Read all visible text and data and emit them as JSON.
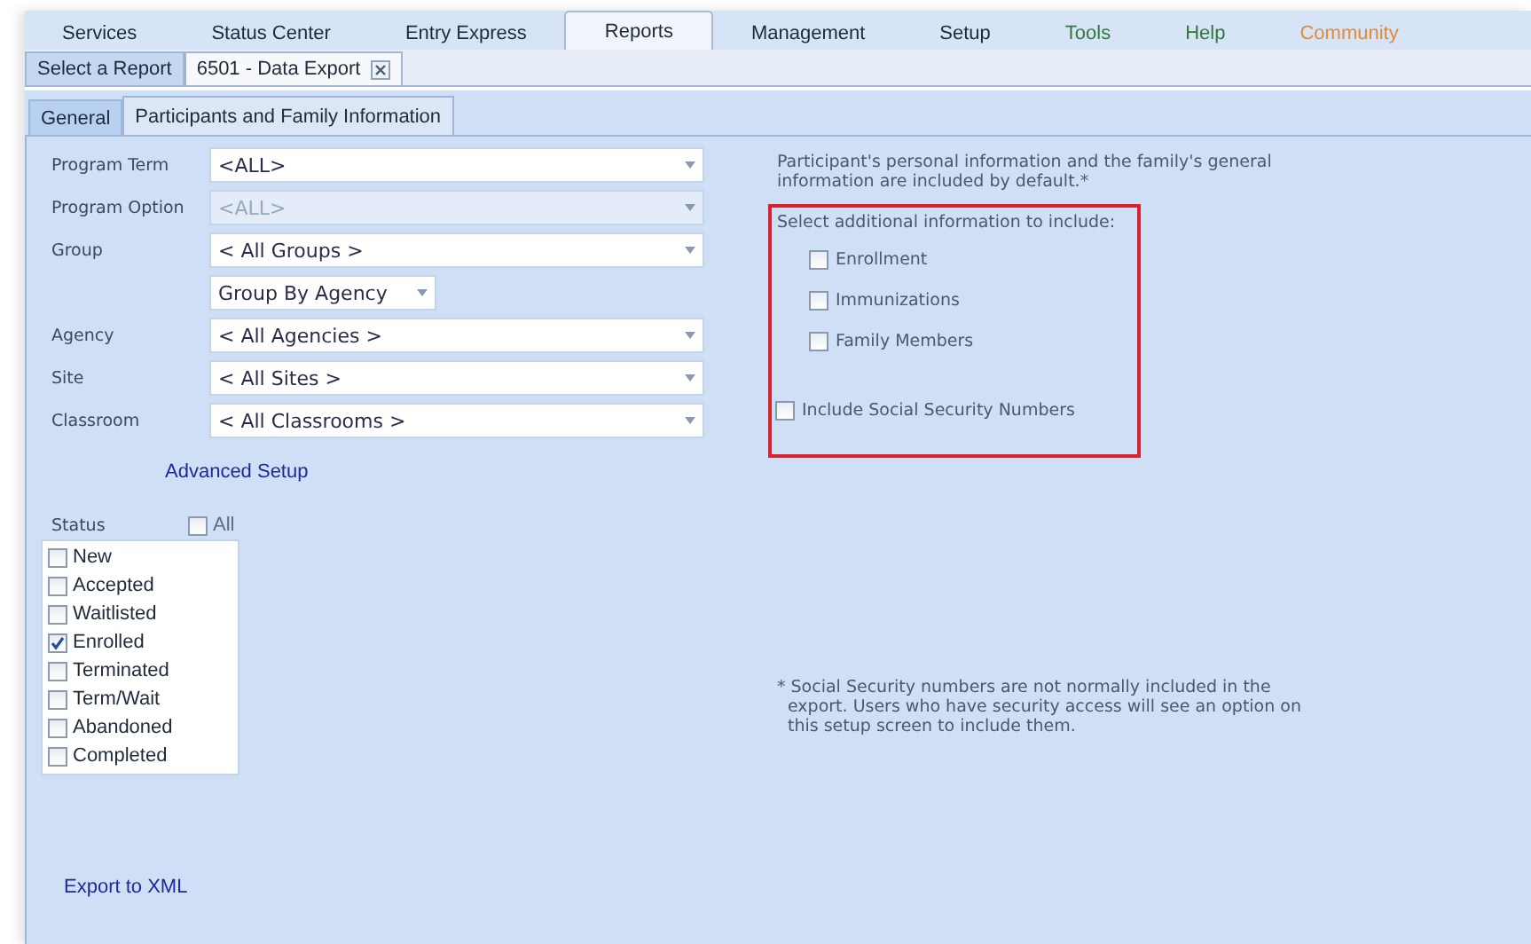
{
  "menu": [
    {
      "label": "Services",
      "selected": false,
      "color": "#1e2a3a"
    },
    {
      "label": "Status Center",
      "selected": false,
      "color": "#1e2a3a"
    },
    {
      "label": "Entry Express",
      "selected": false,
      "color": "#1e2a3a"
    },
    {
      "label": "Reports",
      "selected": true,
      "color": "#1e2a3a"
    },
    {
      "label": "Management",
      "selected": false,
      "color": "#1e2a3a"
    },
    {
      "label": "Setup",
      "selected": false,
      "color": "#1e2a3a"
    },
    {
      "label": "Tools",
      "selected": false,
      "color": "#2f7a3a"
    },
    {
      "label": "Help",
      "selected": false,
      "color": "#2f7a3a"
    },
    {
      "label": "Community",
      "selected": false,
      "color": "#e3893a"
    }
  ],
  "report_tabs": [
    {
      "label": "Select a Report",
      "selected": false,
      "closable": false
    },
    {
      "label": "6501 - Data Export",
      "selected": true,
      "closable": true
    }
  ],
  "sub_tabs": [
    {
      "label": "General",
      "selected": false
    },
    {
      "label": "Participants and Family Information",
      "selected": true
    }
  ],
  "filters": [
    {
      "kind": "combo",
      "label": "Program Term",
      "value": "<ALL>",
      "disabled": false
    },
    {
      "kind": "combo",
      "label": "Program Option",
      "value": "<ALL>",
      "disabled": true
    },
    {
      "kind": "combo",
      "label": "Group",
      "value": "< All Groups >",
      "disabled": false
    },
    {
      "kind": "short-combo",
      "value": "Group By Agency",
      "disabled": false
    },
    {
      "kind": "combo",
      "label": "Agency",
      "value": "< All Agencies >",
      "disabled": false
    },
    {
      "kind": "combo",
      "label": "Site",
      "value": "< All Sites >",
      "disabled": false
    },
    {
      "kind": "combo",
      "label": "Classroom",
      "value": "< All Classrooms >",
      "disabled": false
    }
  ],
  "advanced_link": "Advanced Setup",
  "status": {
    "label": "Status",
    "all": {
      "label": "All",
      "checked": false
    },
    "items": [
      {
        "label": "New",
        "checked": false
      },
      {
        "label": "Accepted",
        "checked": false
      },
      {
        "label": "Waitlisted",
        "checked": false
      },
      {
        "label": "Enrolled",
        "checked": true
      },
      {
        "label": "Terminated",
        "checked": false
      },
      {
        "label": "Term/Wait",
        "checked": false
      },
      {
        "label": "Abandoned",
        "checked": false
      },
      {
        "label": "Completed",
        "checked": false
      }
    ]
  },
  "export_link": "Export to XML",
  "info": {
    "intro": "Participant's personal information and the family's general information are included by default.*",
    "heading": "Select additional information to include:",
    "options": [
      {
        "label": "Enrollment",
        "checked": false
      },
      {
        "label": "Immunizations",
        "checked": false
      },
      {
        "label": "Family Members",
        "checked": false
      }
    ],
    "ssn": {
      "label": "Include Social Security Numbers",
      "checked": false
    },
    "footnote": "* Social Security numbers are not normally included in the export.  Users who have security access will see an option on this setup screen to include them."
  }
}
